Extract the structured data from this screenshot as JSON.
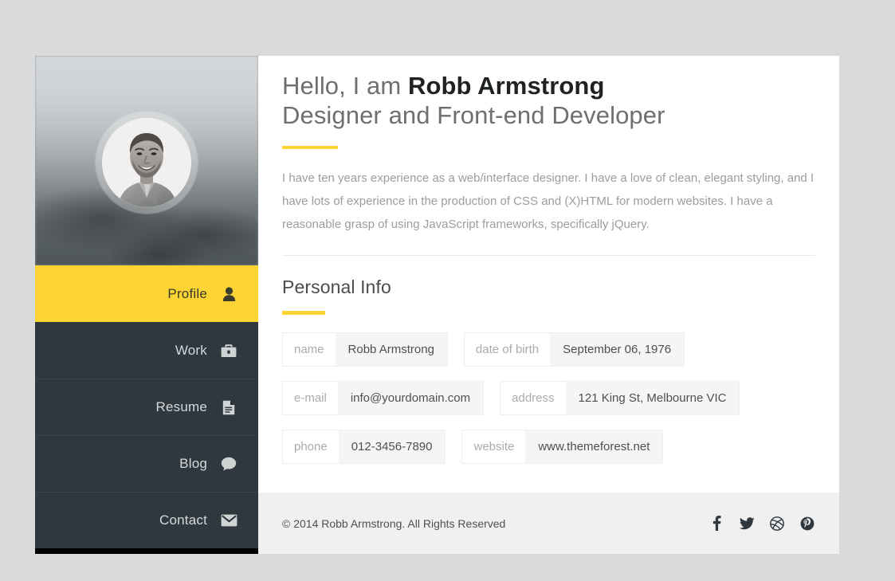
{
  "sidebar": {
    "avatar_alt": "Robb Armstrong portrait",
    "nav": [
      {
        "label": "Profile",
        "icon": "user-icon",
        "active": true
      },
      {
        "label": "Work",
        "icon": "briefcase-icon",
        "active": false
      },
      {
        "label": "Resume",
        "icon": "document-icon",
        "active": false
      },
      {
        "label": "Blog",
        "icon": "speech-bubble-icon",
        "active": false
      },
      {
        "label": "Contact",
        "icon": "envelope-icon",
        "active": false
      }
    ]
  },
  "intro": {
    "greeting": "Hello, I am ",
    "name": "Robb Armstrong",
    "subtitle": "Designer and Front-end Developer",
    "bio": "I have ten years experience as a web/interface designer. I have a love of clean, elegant styling, and I have lots of experience in the production of CSS and (X)HTML for modern websites. I have a reasonable grasp of using JavaScript frameworks, specifically jQuery."
  },
  "personal_info": {
    "section_title": "Personal Info",
    "rows": [
      [
        {
          "label": "name",
          "value": "Robb Armstrong"
        },
        {
          "label": "date of birth",
          "value": "September 06, 1976"
        }
      ],
      [
        {
          "label": "e-mail",
          "value": "info@yourdomain.com"
        },
        {
          "label": "address",
          "value": "121 King St, Melbourne VIC"
        }
      ],
      [
        {
          "label": "phone",
          "value": "012-3456-7890"
        },
        {
          "label": "website",
          "value": "www.themeforest.net"
        }
      ]
    ]
  },
  "footer": {
    "copyright": "© 2014 Robb Armstrong. All Rights Reserved",
    "social": [
      {
        "name": "facebook-icon"
      },
      {
        "name": "twitter-icon"
      },
      {
        "name": "dribbble-icon"
      },
      {
        "name": "pinterest-icon"
      }
    ]
  },
  "colors": {
    "accent_yellow": "#fcd535",
    "sidebar_dark": "#2f383f",
    "page_background": "#d9dadb",
    "footer_background": "#f0f0f0",
    "field_value_background": "#f5f5f5"
  }
}
